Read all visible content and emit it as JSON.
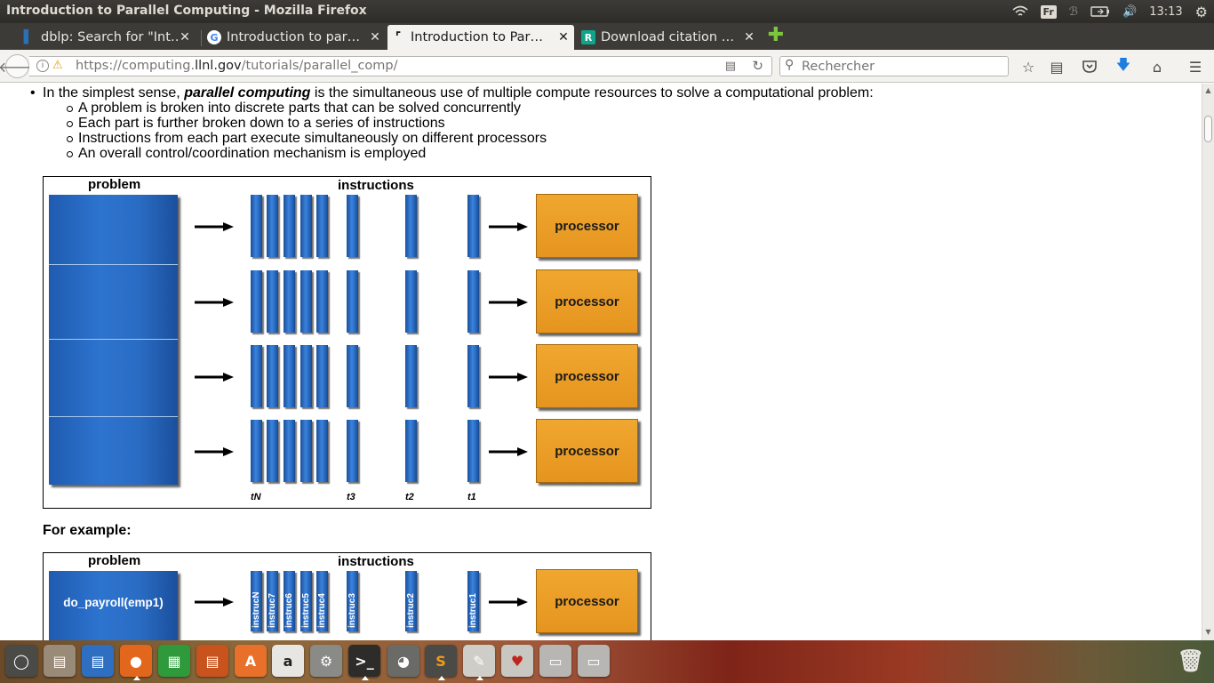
{
  "window": {
    "title": "Introduction to Parallel Computing - Mozilla Firefox"
  },
  "system_tray": {
    "language": "Fr",
    "time": "13:13"
  },
  "tabs": [
    {
      "title": "dblp: Search for \"Int…",
      "favicon": "dblp-icon",
      "active": false
    },
    {
      "title": "Introduction to par…",
      "favicon": "google-icon",
      "active": false
    },
    {
      "title": "Introduction to Par…",
      "favicon": "llnl-icon",
      "active": true
    },
    {
      "title": "Download citation …",
      "favicon": "researchgate-icon",
      "active": false
    }
  ],
  "navbar": {
    "url_prefix": "https://computing.",
    "url_domain": "llnl.gov",
    "url_path": "/tutorials/parallel_comp/",
    "search_placeholder": "Rechercher"
  },
  "content": {
    "intro_before": "In the simplest sense, ",
    "intro_term": "parallel computing",
    "intro_after": " is the simultaneous use of multiple compute resources to solve a computational problem:",
    "sub_items": [
      "A problem is broken into discrete parts that can be solved concurrently",
      "Each part is further broken down to a series of instructions",
      "Instructions from each part execute simultaneously on different processors",
      "An overall control/coordination mechanism is employed"
    ],
    "diagram1": {
      "problem_label": "problem",
      "instructions_label": "instructions",
      "processor_label": "processor",
      "time_labels": [
        "tN",
        "t3",
        "t2",
        "t1"
      ]
    },
    "example_heading": "For example:",
    "diagram2": {
      "problem_label": "problem",
      "instructions_label": "instructions",
      "problem_text": "do_payroll(emp1)",
      "instruction_labels": [
        "instrucN",
        "instruc7",
        "instruc6",
        "instruc5",
        "instruc4",
        "instruc3",
        "instruc2",
        "instruc1"
      ],
      "processor_label": "processor"
    }
  },
  "dock": {
    "apps": [
      "dash-icon",
      "files-icon",
      "writer-icon",
      "firefox-icon",
      "calc-icon",
      "impress-icon",
      "software-center-icon",
      "amazon-icon",
      "settings-icon",
      "terminal-icon",
      "system-monitor-icon",
      "sublime-text-icon",
      "text-editor-icon",
      "pdf-viewer-icon",
      "drive-icon",
      "drive-icon",
      "trash-icon"
    ]
  }
}
